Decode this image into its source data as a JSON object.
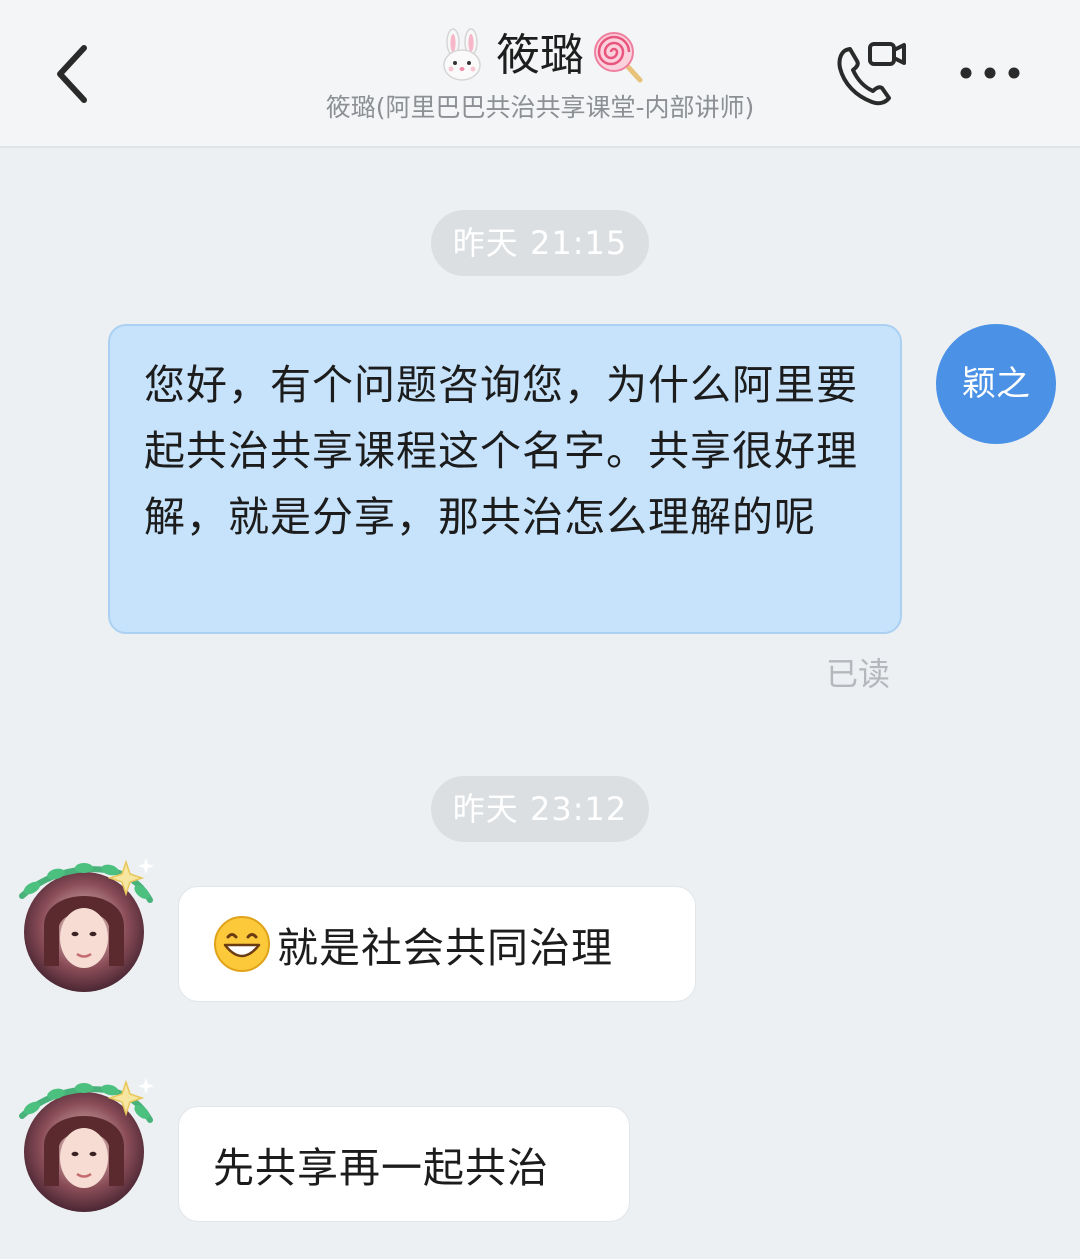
{
  "header": {
    "title": "筱璐",
    "title_left_icon": "bunny-face-icon",
    "title_right_icon": "lollipop-icon",
    "subtitle": "筱璐(阿里巴巴共治共享课堂-内部讲师)",
    "back_icon": "chevron-left-icon",
    "call_icon": "phone-video-call-icon",
    "more_icon": "more-horizontal-icon"
  },
  "messages": [
    {
      "type": "timestamp",
      "text": "昨天 21:15"
    },
    {
      "type": "outgoing",
      "text": "您好，有个问题咨询您，为什么阿里要起共治共享课程这个名字。共享很好理解，就是分享，那共治怎么理解的呢",
      "avatar_text": "颖之",
      "status": "已读"
    },
    {
      "type": "timestamp",
      "text": "昨天 23:12"
    },
    {
      "type": "incoming",
      "emoji_icon": "grinning-face-icon",
      "text": "就是社会共同治理"
    },
    {
      "type": "incoming",
      "text": "先共享再一起共治"
    }
  ],
  "colors": {
    "background": "#edf0f2",
    "outgoing_bubble": "#c6e3fb",
    "self_avatar": "#4b92e6",
    "incoming_bubble": "#ffffff",
    "timestamp_pill": "#dcdfe2"
  }
}
